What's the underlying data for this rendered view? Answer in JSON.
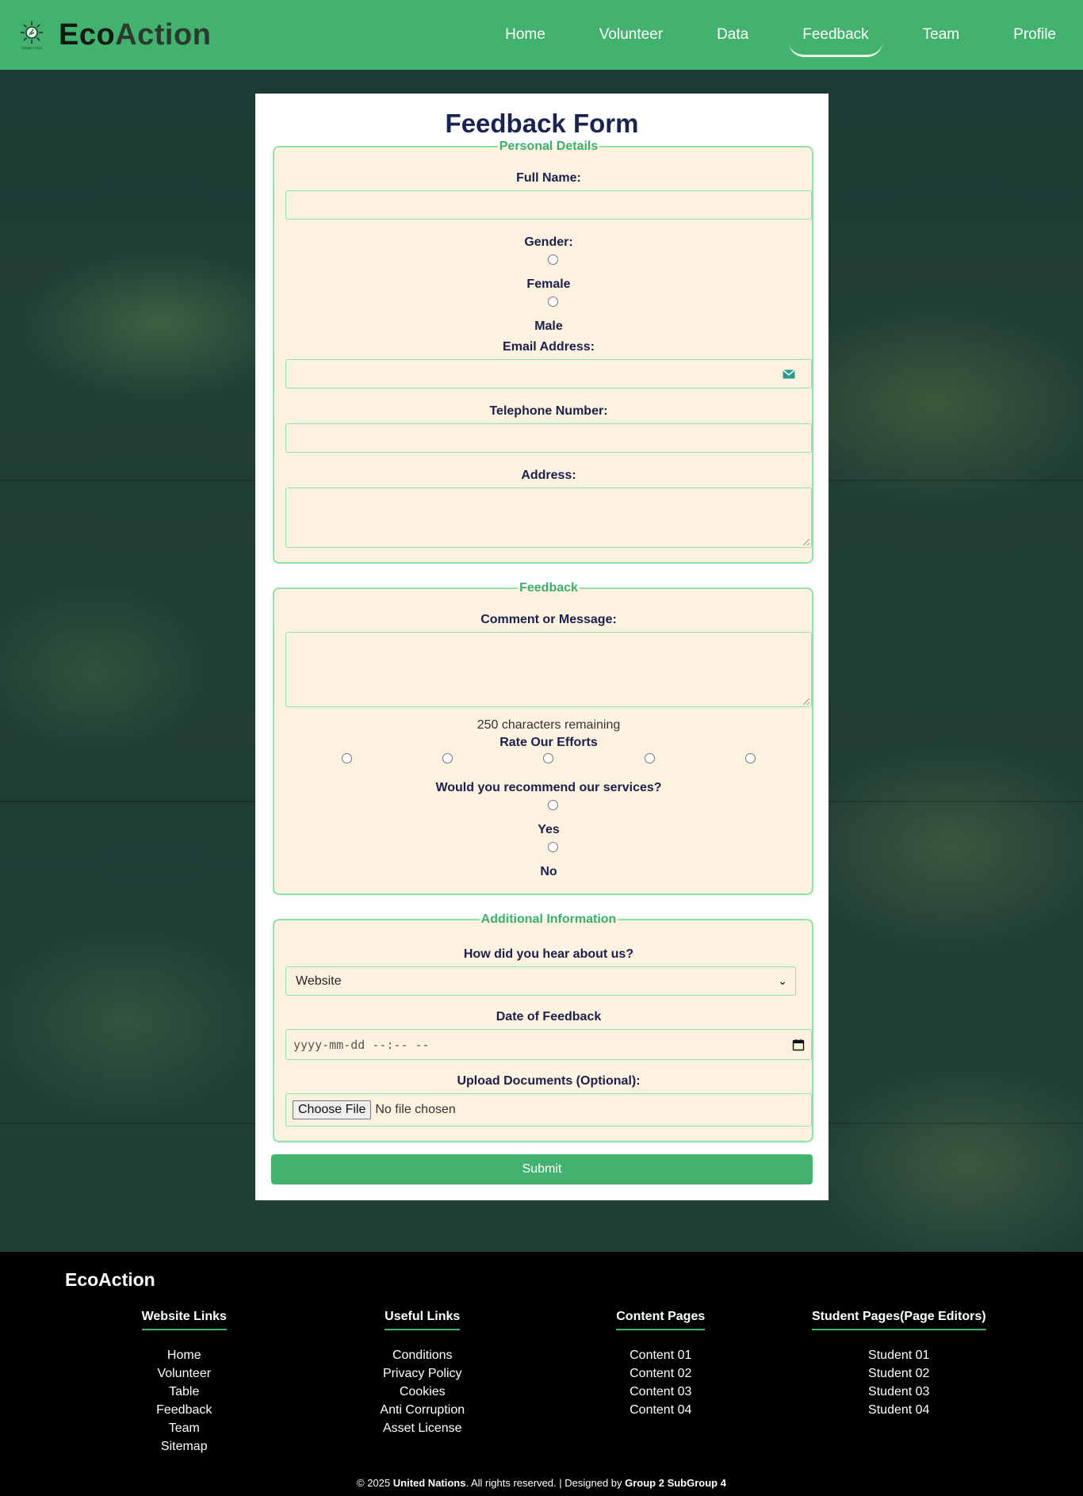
{
  "header": {
    "brand_eco": "Eco",
    "brand_action": "Action",
    "logo_caption": "Climate Action",
    "nav": [
      {
        "label": "Home"
      },
      {
        "label": "Volunteer"
      },
      {
        "label": "Data"
      },
      {
        "label": "Feedback"
      },
      {
        "label": "Team"
      },
      {
        "label": "Profile"
      }
    ]
  },
  "form": {
    "title": "Feedback Form",
    "personal": {
      "legend": "Personal Details",
      "full_name_label": "Full Name:",
      "gender_label": "Gender:",
      "gender_options": [
        "Female",
        "Male"
      ],
      "email_label": "Email Address:",
      "phone_label": "Telephone Number:",
      "address_label": "Address:"
    },
    "feedback": {
      "legend": "Feedback",
      "comment_label": "Comment or Message:",
      "char_remaining": "250 characters remaining",
      "rate_label": "Rate Our Efforts",
      "recommend_label": "Would you recommend our services?",
      "recommend_options": [
        "Yes",
        "No"
      ]
    },
    "additional": {
      "legend": "Additional Information",
      "hear_label": "How did you hear about us?",
      "hear_selected": "Website",
      "date_label": "Date of Feedback",
      "date_placeholder": "yyyy-mm-dd --:-- --",
      "upload_label": "Upload Documents (Optional):",
      "choose_file": "Choose File",
      "no_file": "No file chosen"
    },
    "submit": "Submit"
  },
  "footer": {
    "brand": "EcoAction",
    "columns": [
      {
        "heading": "Website Links",
        "links": [
          "Home",
          "Volunteer",
          "Table",
          "Feedback",
          "Team",
          "Sitemap"
        ]
      },
      {
        "heading": "Useful Links",
        "links": [
          "Conditions",
          "Privacy Policy",
          "Cookies",
          "Anti Corruption",
          "Asset License"
        ]
      },
      {
        "heading": "Content Pages",
        "links": [
          "Content 01",
          "Content 02",
          "Content 03",
          "Content 04"
        ]
      },
      {
        "heading": "Student Pages(Page Editors)",
        "links": [
          "Student 01",
          "Student 02",
          "Student 03",
          "Student 04"
        ]
      }
    ],
    "copy_prefix": "© 2025 ",
    "copy_org": "United Nations",
    "copy_middle": ". All rights reserved. | Designed by ",
    "copy_group": "Group 2 SubGroup 4"
  },
  "colors": {
    "brand_green": "#44b26f",
    "field_bg": "#fdf2e0",
    "field_border": "#8ee3a6",
    "title_navy": "#1a2352"
  }
}
